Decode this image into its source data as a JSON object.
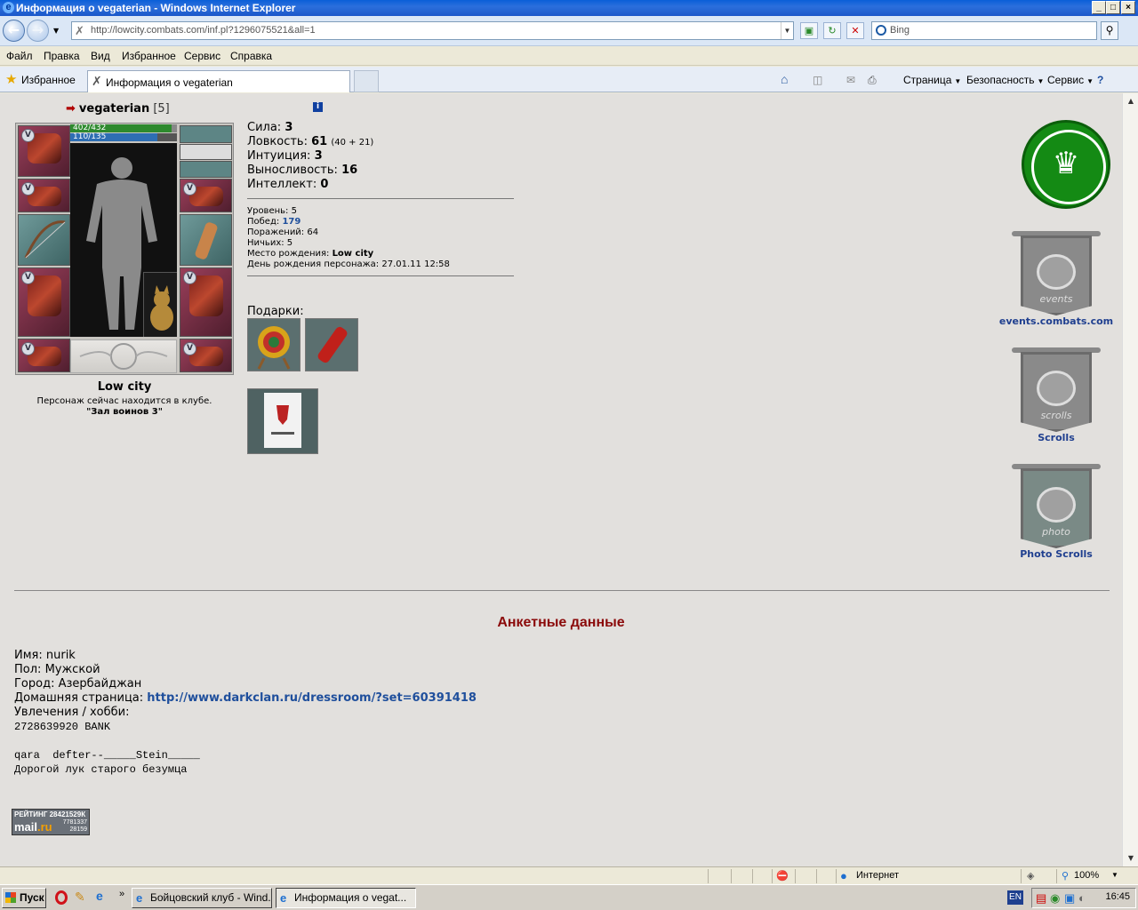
{
  "window": {
    "title": "Информация о vegaterian - Windows Internet Explorer",
    "minimize": "_",
    "maximize": "□",
    "close": "×"
  },
  "address_bar": {
    "url": "http://lowcity.combats.com/inf.pl?1296075521&all=1",
    "search_placeholder": "Bing"
  },
  "menu": [
    "Файл",
    "Правка",
    "Вид",
    "Избранное",
    "Сервис",
    "Справка"
  ],
  "favbar": {
    "favorites_label": "Избранное",
    "tab_title": "Информация о vegaterian",
    "commands": [
      "Страница",
      "Безопасность",
      "Сервис"
    ]
  },
  "character": {
    "name": "vegaterian",
    "level": "[5]",
    "hp": "402/432",
    "mana": "110/135",
    "city": "Low city",
    "club_text": "Персонаж сейчас находится в клубе.",
    "club_location": "\"Зал воинов 3\""
  },
  "stats": {
    "strength": {
      "label": "Сила:",
      "value": "3"
    },
    "agility": {
      "label": "Ловкость:",
      "value": "61",
      "extra": "(40 + 21)"
    },
    "intuition": {
      "label": "Интуиция:",
      "value": "3"
    },
    "endurance": {
      "label": "Выносливость:",
      "value": "16"
    },
    "intellect": {
      "label": "Интеллект:",
      "value": "0"
    }
  },
  "info": {
    "level_label": "Уровень:",
    "level_value": "5",
    "wins_label": "Побед:",
    "wins_value": "179",
    "losses_label": "Поражений:",
    "losses_value": "64",
    "draws_label": "Ничьих:",
    "draws_value": "5",
    "birthplace_label": "Место рождения:",
    "birthplace_value": "Low city",
    "birthday_label": "День рождения персонажа:",
    "birthday_value": "27.01.11 12:58"
  },
  "gifts": {
    "title": "Подарки:"
  },
  "sidebar": {
    "events_label": "events.combats.com",
    "events_word": "events",
    "scrolls_label": "Scrolls",
    "scrolls_word": "scrolls",
    "photo_label": "Photo Scrolls",
    "photo_word": "photo"
  },
  "profile": {
    "title": "Анкетные данные",
    "name_label": "Имя:",
    "name_value": "nurik",
    "gender_label": "Пол:",
    "gender_value": "Мужской",
    "city_label": "Город:",
    "city_value": "Азербайджан",
    "home_label": "Домашняя страница:",
    "home_value": "http://www.darkclan.ru/dressroom/?set=60391418",
    "hobby_label": "Увлечения / хобби:",
    "hobby_line1": "2728639920 BANK",
    "hobby_line2": "qara  defter--_____Stein_____",
    "hobby_line3": "Дорогой лук старого безумца"
  },
  "counter": {
    "rating": "РЕЙТИНГ 28421529К",
    "brand_a": "mail",
    "brand_b": ".ru",
    "n1": "7781337",
    "n2": "28159"
  },
  "statusbar": {
    "zone": "Интернет",
    "zoom": "100%"
  },
  "taskbar": {
    "start": "Пуск",
    "task1": "Бойцовский клуб - Wind...",
    "task2": "Информация о vegat...",
    "lang": "EN",
    "clock": "16:45"
  }
}
